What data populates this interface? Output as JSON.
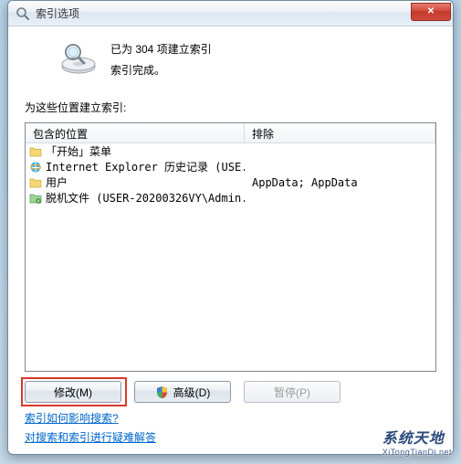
{
  "window": {
    "title": "索引选项",
    "close_glyph": "✕"
  },
  "status": {
    "line1": "已为 304 项建立索引",
    "line2": "索引完成。"
  },
  "section_label": "为这些位置建立索引:",
  "columns": {
    "location": "包含的位置",
    "exclude": "排除"
  },
  "rows": [
    {
      "icon": "folder",
      "label": "「开始」菜单",
      "exclude": ""
    },
    {
      "icon": "ie",
      "label": "Internet Explorer 历史记录 (USE...",
      "exclude": ""
    },
    {
      "icon": "folder",
      "label": "用户",
      "exclude": "AppData; AppData"
    },
    {
      "icon": "offline",
      "label": "脱机文件 (USER-20200326VY\\Admin...",
      "exclude": ""
    }
  ],
  "buttons": {
    "modify": "修改(M)",
    "advanced": "高级(D)",
    "pause": "暂停(P)"
  },
  "links": {
    "how": "索引如何影响搜索?",
    "trouble": "对搜索和索引进行疑难解答"
  },
  "watermark": {
    "main": "系统天地",
    "sub": "XiTongTianDi.net"
  }
}
